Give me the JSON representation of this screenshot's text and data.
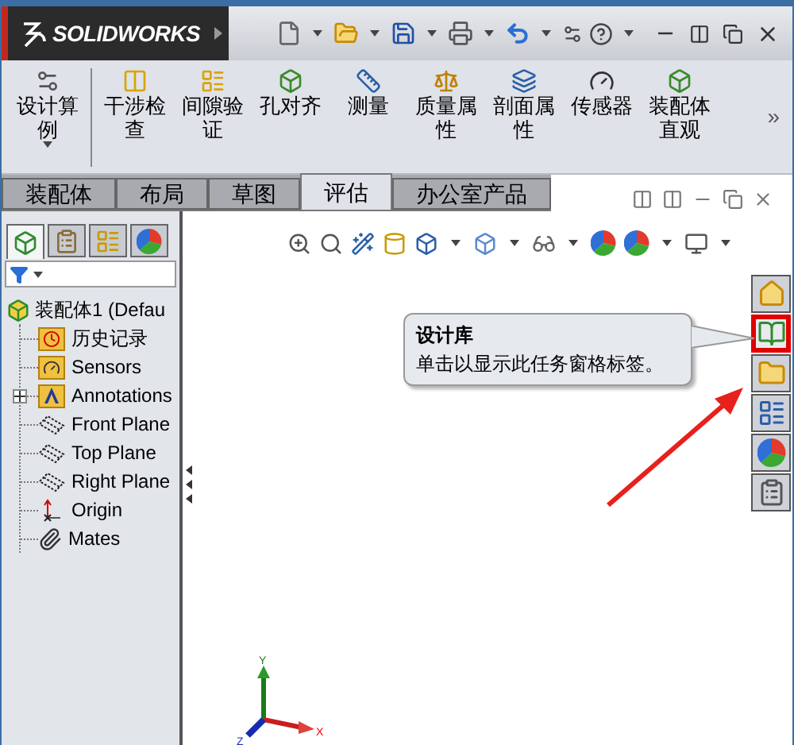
{
  "title_bar": {
    "logo": "SOLIDWORKS"
  },
  "toolbar": {
    "items": [
      {
        "label": "设计算例",
        "kind": "study"
      },
      {
        "label": "干涉检查",
        "kind": "interference"
      },
      {
        "label": "间隙验证",
        "kind": "clearance"
      },
      {
        "label": "孔对齐",
        "kind": "hole"
      },
      {
        "label": "测量",
        "kind": "measure"
      },
      {
        "label": "质量属性",
        "kind": "mass"
      },
      {
        "label": "剖面属性",
        "kind": "section"
      },
      {
        "label": "传感器",
        "kind": "sensor"
      },
      {
        "label": "装配体直观",
        "kind": "visual"
      }
    ],
    "more": "»"
  },
  "tabs": [
    {
      "label": "装配体",
      "selected": false
    },
    {
      "label": "布局",
      "selected": false
    },
    {
      "label": "草图",
      "selected": false
    },
    {
      "label": "评估",
      "selected": true
    },
    {
      "label": "办公室产品",
      "selected": false
    }
  ],
  "panel_tabs": [
    {
      "kind": "feature",
      "selected": true
    },
    {
      "kind": "property",
      "selected": false
    },
    {
      "kind": "config",
      "selected": false
    },
    {
      "kind": "display",
      "selected": false
    }
  ],
  "feature_tree": {
    "root": "装配体1  (Defau",
    "children": [
      {
        "label": "历史记录",
        "kind": "history",
        "has_children": false
      },
      {
        "label": "Sensors",
        "kind": "sensors",
        "has_children": false
      },
      {
        "label": "Annotations",
        "kind": "annotations",
        "has_children": true
      },
      {
        "label": "Front Plane",
        "kind": "plane",
        "has_children": false
      },
      {
        "label": "Top Plane",
        "kind": "plane",
        "has_children": false
      },
      {
        "label": "Right Plane",
        "kind": "plane",
        "has_children": false
      },
      {
        "label": "Origin",
        "kind": "origin",
        "has_children": false
      },
      {
        "label": "Mates",
        "kind": "mates",
        "has_children": false
      }
    ]
  },
  "task_pane": [
    {
      "kind": "home",
      "selected": false
    },
    {
      "kind": "library",
      "selected": true
    },
    {
      "kind": "folder",
      "selected": false
    },
    {
      "kind": "palette",
      "selected": false
    },
    {
      "kind": "appearance",
      "selected": false
    },
    {
      "kind": "properties",
      "selected": false
    }
  ],
  "tooltip": {
    "title": "设计库",
    "body": "单击以显示此任务窗格标签。"
  },
  "triad": {
    "x": "X",
    "y": "Y",
    "z": "Z"
  }
}
